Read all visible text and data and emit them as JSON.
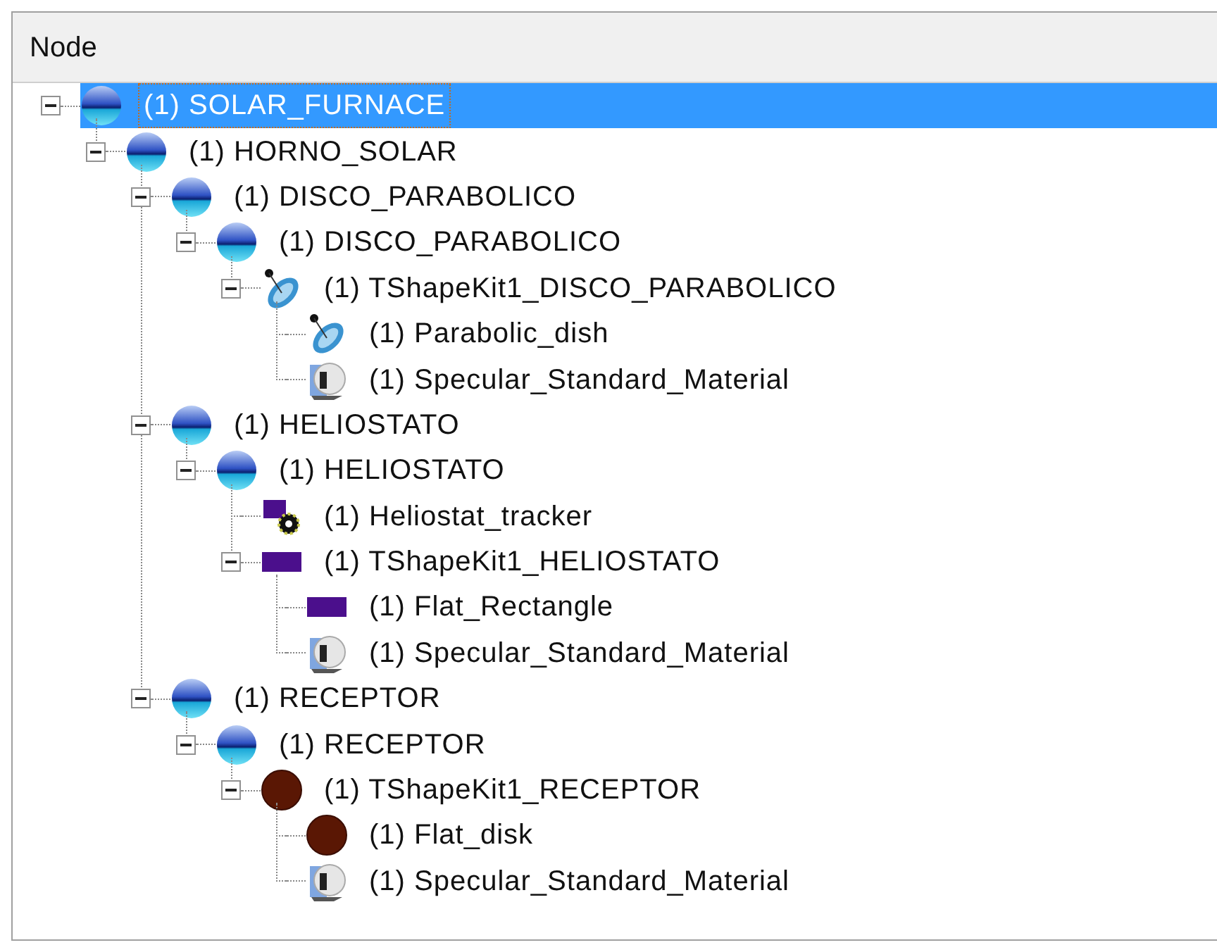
{
  "header": {
    "title": "Node"
  },
  "tree": [
    {
      "label": "(1) SOLAR_FURNACE",
      "kind": "separator",
      "selected": true,
      "expanded": true,
      "children": [
        {
          "label": "(1) HORNO_SOLAR",
          "kind": "separator",
          "selected": false,
          "expanded": true,
          "children": [
            {
              "label": "(1) DISCO_PARABOLICO",
              "kind": "separator",
              "selected": false,
              "expanded": true,
              "children": [
                {
                  "label": "(1) DISCO_PARABOLICO",
                  "kind": "separator",
                  "selected": false,
                  "expanded": true,
                  "children": [
                    {
                      "label": "(1) TShapeKit1_DISCO_PARABOLICO",
                      "kind": "dish",
                      "selected": false,
                      "expanded": true,
                      "children": [
                        {
                          "label": "(1) Parabolic_dish",
                          "kind": "dish",
                          "selected": false
                        },
                        {
                          "label": "(1) Specular_Standard_Material",
                          "kind": "material",
                          "selected": false
                        }
                      ]
                    }
                  ]
                }
              ]
            },
            {
              "label": "(1) HELIOSTATO",
              "kind": "separator",
              "selected": false,
              "expanded": true,
              "children": [
                {
                  "label": "(1) HELIOSTATO",
                  "kind": "separator",
                  "selected": false,
                  "expanded": true,
                  "children": [
                    {
                      "label": "(1) Heliostat_tracker",
                      "kind": "tracker",
                      "selected": false
                    },
                    {
                      "label": "(1) TShapeKit1_HELIOSTATO",
                      "kind": "rectangle",
                      "selected": false,
                      "expanded": true,
                      "children": [
                        {
                          "label": "(1) Flat_Rectangle",
                          "kind": "rectangle",
                          "selected": false
                        },
                        {
                          "label": "(1) Specular_Standard_Material",
                          "kind": "material",
                          "selected": false
                        }
                      ]
                    }
                  ]
                }
              ]
            },
            {
              "label": "(1) RECEPTOR",
              "kind": "separator",
              "selected": false,
              "expanded": true,
              "children": [
                {
                  "label": "(1) RECEPTOR",
                  "kind": "separator",
                  "selected": false,
                  "expanded": true,
                  "children": [
                    {
                      "label": "(1) TShapeKit1_RECEPTOR",
                      "kind": "disk",
                      "selected": false,
                      "expanded": true,
                      "children": [
                        {
                          "label": "(1) Flat_disk",
                          "kind": "disk",
                          "selected": false
                        },
                        {
                          "label": "(1) Specular_Standard_Material",
                          "kind": "material",
                          "selected": false
                        }
                      ]
                    }
                  ]
                }
              ]
            }
          ]
        }
      ]
    }
  ]
}
